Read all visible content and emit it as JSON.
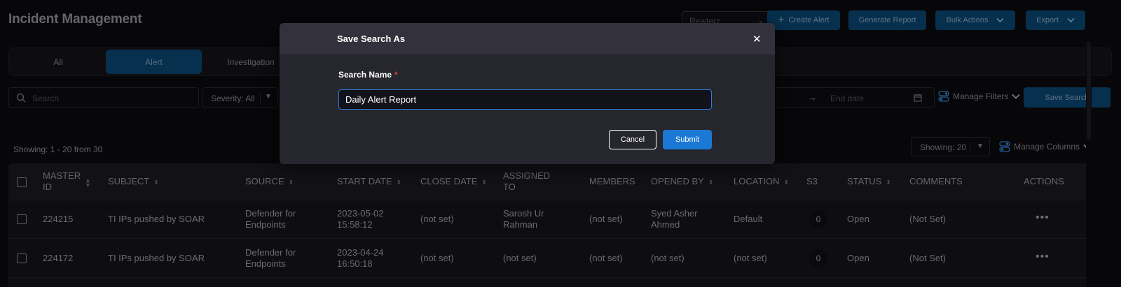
{
  "header": {
    "title": "Incident Management",
    "org_select": "Rewterz",
    "create_alert": "Create Alert",
    "generate_report": "Generate Report",
    "bulk_actions": "Bulk Actions",
    "export": "Export"
  },
  "tabs": [
    {
      "label": "All",
      "active": false
    },
    {
      "label": "Alert",
      "active": true
    },
    {
      "label": "Investigation",
      "active": false
    }
  ],
  "filters": {
    "search_placeholder": "Search",
    "severity": "Severity: All",
    "end_date_placeholder": "End date",
    "manage_filters": "Manage Filters",
    "save_search": "Save Search"
  },
  "listing": {
    "showing_text": "Showing: 1 - 20 from 30",
    "page_size": "Showing: 20",
    "manage_columns": "Manage Columns"
  },
  "table": {
    "columns": {
      "master_id": [
        "MASTER",
        "ID"
      ],
      "subject": "SUBJECT",
      "source": "SOURCE",
      "start_date": "START DATE",
      "close_date": "CLOSE DATE",
      "assigned_to": [
        "ASSIGNED",
        "TO"
      ],
      "members": "MEMBERS",
      "opened_by": "OPENED BY",
      "location": "LOCATION",
      "s3": "S3",
      "status": "STATUS",
      "comments": "COMMENTS",
      "actions": "ACTIONS"
    },
    "rows": [
      {
        "id": "224215",
        "subject": "TI IPs pushed by SOAR",
        "source": [
          "Defender for",
          "Endpoints"
        ],
        "start": [
          "2023-05-02",
          "15:58:12"
        ],
        "close": "(not set)",
        "assigned": [
          "Sarosh Ur",
          "Rahman"
        ],
        "members": "(not set)",
        "opened_by": [
          "Syed Asher",
          "Ahmed"
        ],
        "location": "Default",
        "s3": "0",
        "status": "Open",
        "comments": "(Not Set)",
        "actions": "•••"
      },
      {
        "id": "224172",
        "subject": "TI IPs pushed by SOAR",
        "source": [
          "Defender for",
          "Endpoints"
        ],
        "start": [
          "2023-04-24",
          "16:50:18"
        ],
        "close": "(not set)",
        "assigned": [
          "(not set)",
          ""
        ],
        "members": "(not set)",
        "opened_by": [
          "(not set)",
          ""
        ],
        "location": "(not set)",
        "s3": "0",
        "status": "Open",
        "comments": "(Not Set)",
        "actions": "•••"
      }
    ]
  },
  "modal": {
    "title": "Save Search As",
    "close_glyph": "✕",
    "field_label": "Search Name",
    "required_mark": "*",
    "field_value": "Daily Alert Report",
    "cancel": "Cancel",
    "submit": "Submit"
  },
  "colors": {
    "accent": "#1b78d4",
    "primary_button": "#0c4a78",
    "background": "#0b0b0f",
    "required": "#e04040"
  }
}
